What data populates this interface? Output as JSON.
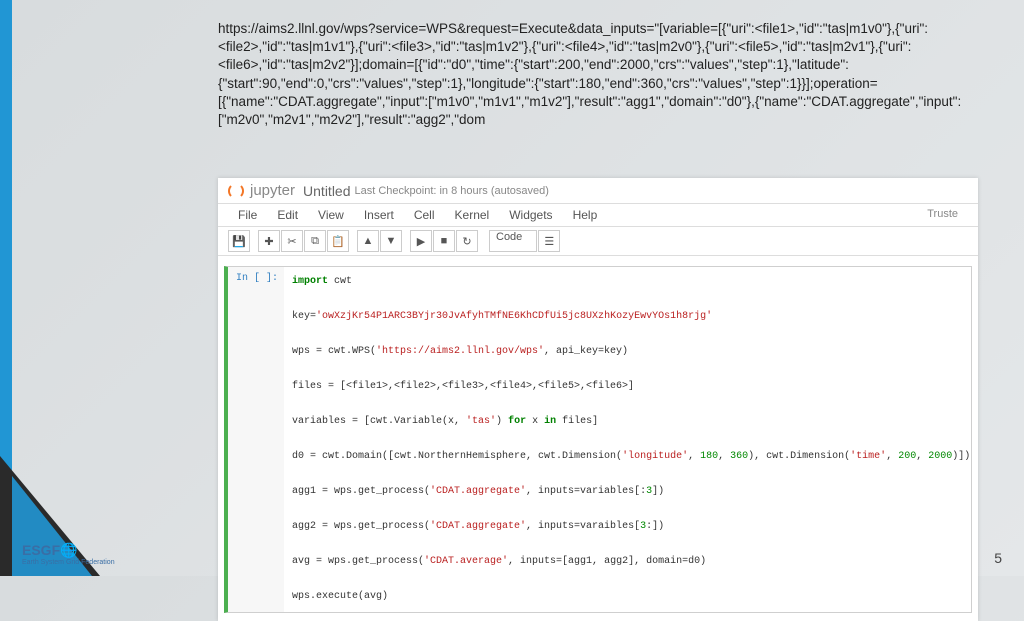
{
  "url_text": "https://aims2.llnl.gov/wps?service=WPS&request=Execute&data_inputs=\"[variable=[{\"uri\":<file1>,\"id\":\"tas|m1v0\"},{\"uri\":<file2>,\"id\":\"tas|m1v1\"},{\"uri\":<file3>,\"id\":\"tas|m1v2\"},{\"uri\":<file4>,\"id\":\"tas|m2v0\"},{\"uri\":<file5>,\"id\":\"tas|m2v1\"},{\"uri\":<file6>,\"id\":\"tas|m2v2\"}];domain=[{\"id\":\"d0\",\"time\":{\"start\":200,\"end\":2000,\"crs\":\"values\",\"step\":1},\"latitude\":{\"start\":90,\"end\":0,\"crs\":\"values\",\"step\":1},\"longitude\":{\"start\":180,\"end\":360,\"crs\":\"values\",\"step\":1}}];operation=[{\"name\":\"CDAT.aggregate\",\"input\":[\"m1v0\",\"m1v1\",\"m1v2\"],\"result\":\"agg1\",\"domain\":\"d0\"},{\"name\":\"CDAT.aggregate\",\"input\":[\"m2v0\",\"m2v1\",\"m2v2\"],\"result\":\"agg2\",\"dom",
  "jupyter": {
    "brand": "jupyter",
    "title": "Untitled",
    "checkpoint": "Last Checkpoint: in 8 hours (autosaved)",
    "menu": [
      "File",
      "Edit",
      "View",
      "Insert",
      "Cell",
      "Kernel",
      "Widgets",
      "Help"
    ],
    "trusted": "Truste",
    "celltype": "Code",
    "prompt": "In [ ]:"
  },
  "code": {
    "l1a": "import",
    "l1b": " cwt",
    "l2a": "key=",
    "l2b": "'owXzjKr54P1ARC3BYjr30JvAfyhTMfNE6KhCDfUi5jc8UXzhKozyEwvYOs1h8rjg'",
    "l3a": "wps = cwt.WPS(",
    "l3b": "'https://aims2.llnl.gov/wps'",
    "l3c": ", api_key=key)",
    "l4": "files = [<file1>,<file2>,<file3>,<file4>,<file5>,<file6>]",
    "l5a": "variables = [cwt.Variable(x, ",
    "l5b": "'tas'",
    "l5c": ") ",
    "l5d": "for",
    "l5e": " x ",
    "l5f": "in",
    "l5g": " files]",
    "l6a": "d0 = cwt.Domain([cwt.NorthernHemisphere, cwt.Dimension(",
    "l6b": "'longitude'",
    "l6c": ", ",
    "l6d": "180",
    "l6e": ", ",
    "l6f": "360",
    "l6g": "), cwt.Dimension(",
    "l6h": "'time'",
    "l6i": ", ",
    "l6j": "200",
    "l6k": ", ",
    "l6l": "2000",
    "l6m": ")])",
    "l7a": "agg1 = wps.get_process(",
    "l7b": "'CDAT.aggregate'",
    "l7c": ", inputs=variables[:",
    "l7d": "3",
    "l7e": "])",
    "l8a": "agg2 = wps.get_process(",
    "l8b": "'CDAT.aggregate'",
    "l8c": ", inputs=varaibles[",
    "l8d": "3",
    "l8e": ":])",
    "l9a": "avg = wps.get_process(",
    "l9b": "'CDAT.average'",
    "l9c": ", inputs=[agg1, agg2], domain=d0)",
    "l10": "wps.execute(avg)"
  },
  "footer": {
    "logo": "ESGF",
    "sub": "Earth System Grid Federation",
    "page": "5"
  }
}
